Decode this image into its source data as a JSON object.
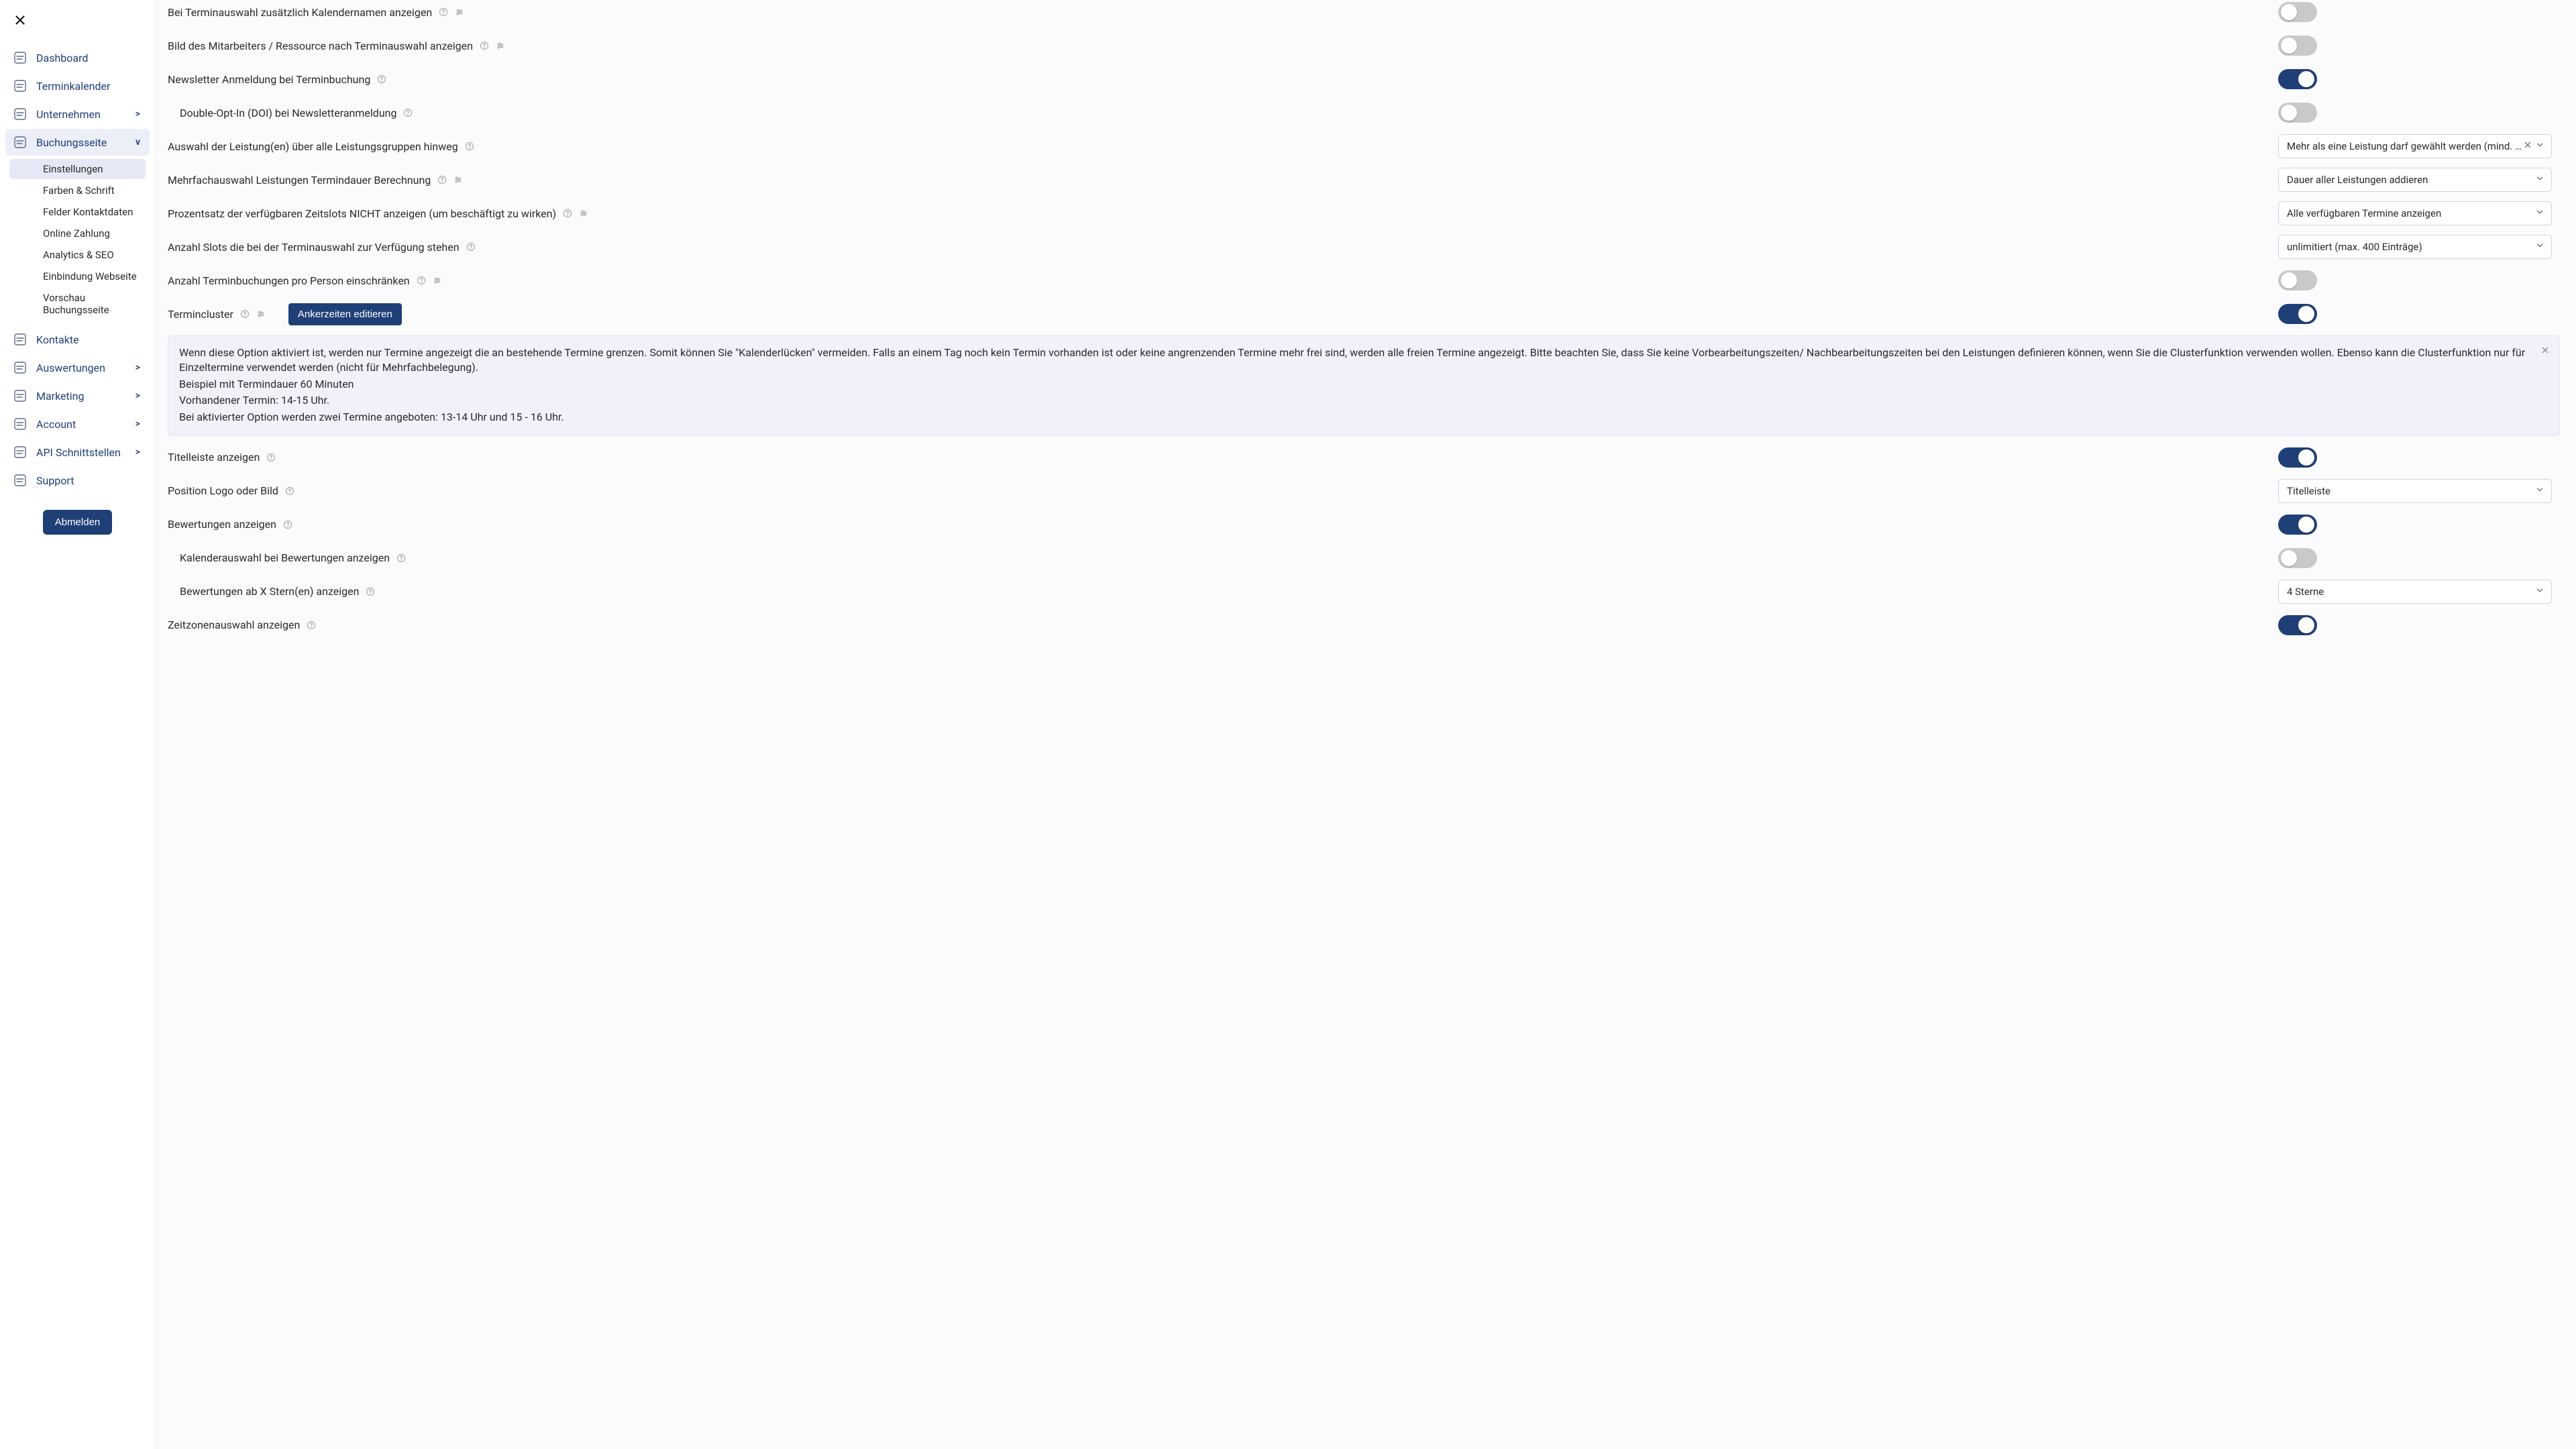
{
  "sidebar": {
    "items": [
      {
        "label": "Dashboard"
      },
      {
        "label": "Terminkalender"
      },
      {
        "label": "Unternehmen",
        "expandable": true
      },
      {
        "label": "Buchungsseite",
        "expandable": true,
        "expanded": true,
        "children": [
          {
            "label": "Einstellungen",
            "active": true
          },
          {
            "label": "Farben & Schrift"
          },
          {
            "label": "Felder Kontaktdaten"
          },
          {
            "label": "Online Zahlung"
          },
          {
            "label": "Analytics & SEO"
          },
          {
            "label": "Einbindung Webseite"
          },
          {
            "label": "Vorschau Buchungsseite"
          }
        ]
      },
      {
        "label": "Kontakte"
      },
      {
        "label": "Auswertungen",
        "expandable": true
      },
      {
        "label": "Marketing",
        "expandable": true
      },
      {
        "label": "Account",
        "expandable": true
      },
      {
        "label": "API Schnittstellen",
        "expandable": true
      },
      {
        "label": "Support"
      }
    ],
    "logout": "Abmelden"
  },
  "settings": {
    "rows": {
      "cal_name_on_select": {
        "label": "Bei Terminauswahl zusätzlich Kalendernamen anzeigen",
        "on": false,
        "help": true,
        "sliders": true
      },
      "employee_image": {
        "label": "Bild des Mitarbeiters / Ressource nach Terminauswahl anzeigen",
        "on": false,
        "help": true,
        "sliders": true
      },
      "newsletter": {
        "label": "Newsletter Anmeldung bei Terminbuchung",
        "on": true,
        "help": true
      },
      "doi": {
        "label": "Double-Opt-In (DOI) bei Newsletteranmeldung",
        "on": false,
        "help": true,
        "indent": true
      },
      "service_across_groups": {
        "label": "Auswahl der Leistung(en) über alle Leistungsgruppen hinweg",
        "help": true,
        "select": "Mehr als eine Leistung darf gewählt werden (mind. eine Leistung)",
        "clearable": true
      },
      "multi_duration": {
        "label": "Mehrfachauswahl Leistungen Termindauer Berechnung",
        "help": true,
        "sliders": true,
        "select": "Dauer aller Leistungen addieren"
      },
      "hide_slots_pct": {
        "label": "Prozentsatz der verfügbaren Zeitslots NICHT anzeigen (um beschäftigt zu wirken)",
        "help": true,
        "sliders": true,
        "select": "Alle verfügbaren Termine anzeigen"
      },
      "slot_count": {
        "label": "Anzahl Slots die bei der Terminauswahl zur Verfügung stehen",
        "help": true,
        "select": "unlimitiert (max. 400 Einträge)"
      },
      "limit_per_person": {
        "label": "Anzahl Terminbuchungen pro Person einschränken",
        "on": false,
        "help": true,
        "sliders": true
      },
      "cluster": {
        "label": "Termincluster",
        "on": true,
        "help": true,
        "sliders": true,
        "button": "Ankerzeiten editieren"
      },
      "title_bar": {
        "label": "Titelleiste anzeigen",
        "on": true,
        "help": true
      },
      "logo_pos": {
        "label": "Position Logo oder Bild",
        "help": true,
        "select": "Titelleiste"
      },
      "reviews": {
        "label": "Bewertungen anzeigen",
        "on": true,
        "help": true
      },
      "reviews_cal": {
        "label": "Kalenderauswahl bei Bewertungen anzeigen",
        "on": false,
        "help": true,
        "indent": true
      },
      "reviews_min_stars": {
        "label": "Bewertungen ab X Stern(en) anzeigen",
        "help": true,
        "indent": true,
        "select": "4 Sterne"
      },
      "timezone": {
        "label": "Zeitzonenauswahl anzeigen",
        "on": true,
        "help": true
      }
    },
    "callout": {
      "p1": "Wenn diese Option aktiviert ist, werden nur Termine angezeigt die an bestehende Termine grenzen. Somit können Sie \"Kalenderlücken\" vermeiden. Falls an einem Tag noch kein Termin vorhanden ist oder keine angrenzenden Termine mehr frei sind, werden alle freien Termine angezeigt. Bitte beachten Sie, dass Sie keine Vorbearbeitungszeiten/ Nachbearbeitungszeiten bei den Leistungen definieren können, wenn Sie die Clusterfunktion verwenden wollen. Ebenso kann die Clusterfunktion nur für Einzeltermine verwendet werden (nicht für Mehrfachbelegung).",
      "p2": "Beispiel mit Termindauer 60 Minuten",
      "p3": "Vorhandener Termin: 14-15 Uhr.",
      "p4": "Bei aktivierter Option werden zwei Termine angeboten: 13-14 Uhr und 15 - 16 Uhr."
    }
  }
}
